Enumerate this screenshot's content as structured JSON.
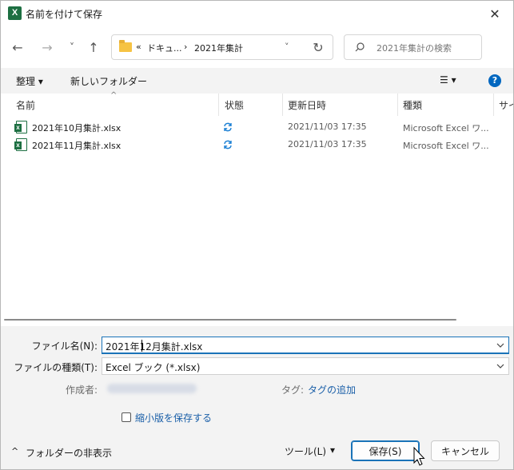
{
  "window": {
    "title": "名前を付けて保存",
    "app_icon_letter": "X",
    "close_glyph": "✕"
  },
  "nav": {
    "back_glyph": "←",
    "forward_glyph": "→",
    "recent_glyph": "˅",
    "up_glyph": "↑",
    "breadcrumb_overflow": "«",
    "breadcrumb_parent": "ドキュ...",
    "breadcrumb_sep": "›",
    "breadcrumb_current": "2021年集計",
    "address_dropdown_glyph": "˅",
    "refresh_glyph": "↻",
    "search_placeholder": "2021年集計の検索"
  },
  "toolbar": {
    "organize_label": "整理 ▾",
    "new_folder_label": "新しいフォルダー",
    "view_label": "☰ ▾",
    "help_glyph": "?"
  },
  "columns": {
    "name": "名前",
    "status": "状態",
    "modified": "更新日時",
    "type": "種類",
    "size": "サイ",
    "sort_glyph": "^"
  },
  "files": [
    {
      "name": "2021年10月集計.xlsx",
      "modified": "2021/11/03 17:35",
      "type": "Microsoft Excel ワ..."
    },
    {
      "name": "2021年11月集計.xlsx",
      "modified": "2021/11/03 17:35",
      "type": "Microsoft Excel ワ..."
    }
  ],
  "form": {
    "filename_label": "ファイル名(N):",
    "filename_value": "2021年12月集計.xlsx",
    "filetype_label": "ファイルの種類(T):",
    "filetype_value": "Excel ブック (*.xlsx)",
    "author_label": "作成者:",
    "tag_label": "タグ:",
    "tag_link": "タグの追加",
    "thumbnail_label": "縮小版を保存する"
  },
  "bottom": {
    "hide_folders_label": "フォルダーの非表示",
    "hide_folders_glyph": "^",
    "tools_label": "ツール(L)",
    "tools_glyph": "▾",
    "save_label": "保存(S)",
    "cancel_label": "キャンセル"
  },
  "colors": {
    "excel_green": "#1d6f42",
    "accent_blue": "#1a73b8",
    "link_blue": "#1a5fa8",
    "help_blue": "#0067c0",
    "sync_blue": "#1a7fd4",
    "panel_gray": "#f3f3f3"
  }
}
